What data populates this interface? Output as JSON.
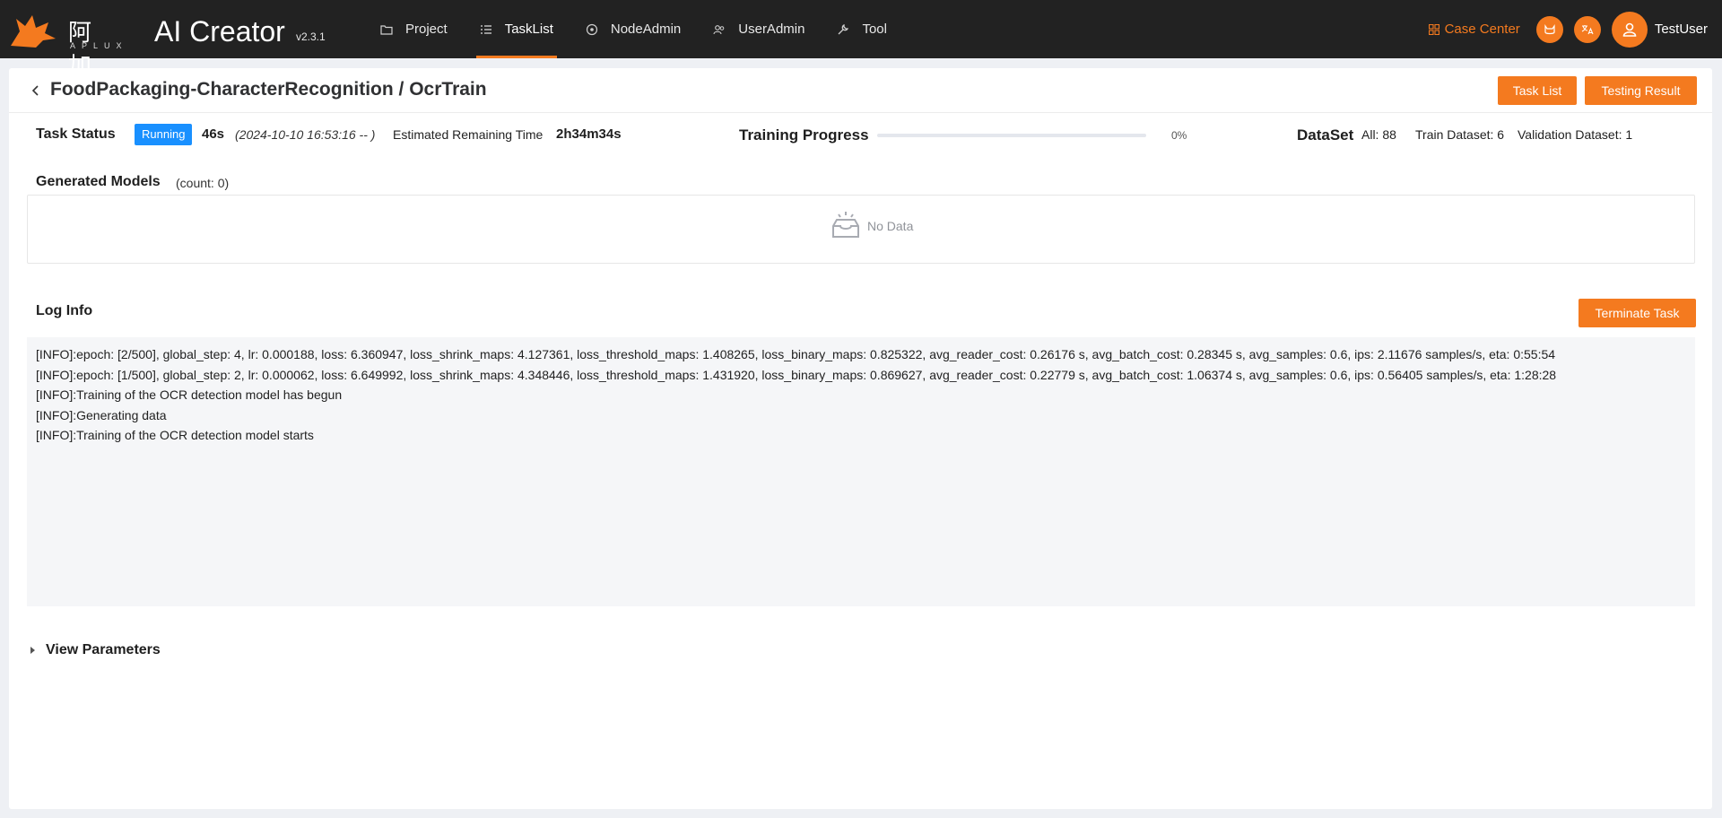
{
  "app": {
    "brand_cn": "阿加犀",
    "brand_sub": "APLUX",
    "brand_name": "AI Creator",
    "version": "v2.3.1",
    "accent_color": "#f47a1f"
  },
  "nav": {
    "items": [
      {
        "label": "Project",
        "icon": "folder-icon"
      },
      {
        "label": "TaskList",
        "icon": "tasklist-icon",
        "active": true
      },
      {
        "label": "NodeAdmin",
        "icon": "node-icon"
      },
      {
        "label": "UserAdmin",
        "icon": "users-icon"
      },
      {
        "label": "Tool",
        "icon": "wrench-icon"
      }
    ],
    "case_center": "Case Center",
    "username": "TestUser"
  },
  "page": {
    "title": "FoodPackaging-CharacterRecognition / OcrTrain",
    "task_list_button": "Task List",
    "testing_result_button": "Testing Result"
  },
  "status": {
    "label": "Task Status",
    "badge": "Running",
    "elapsed": "46s",
    "start_time": "(2024-10-10 16:53:16 -- )",
    "estimated_label": "Estimated Remaining Time",
    "estimated_value": "2h34m34s"
  },
  "progress": {
    "label": "Training Progress",
    "percent_text": "0%",
    "value": 0
  },
  "dataset": {
    "label": "DataSet",
    "all": "All: 88",
    "train": "Train Dataset: 6",
    "validation": "Validation Dataset: 1"
  },
  "models": {
    "title": "Generated Models",
    "count": "(count:  0)",
    "empty_text": "No Data"
  },
  "log": {
    "title": "Log Info",
    "terminate_button": "Terminate Task",
    "lines": [
      "[INFO]:epoch: [2/500], global_step: 4, lr: 0.000188, loss: 6.360947, loss_shrink_maps: 4.127361, loss_threshold_maps: 1.408265, loss_binary_maps: 0.825322, avg_reader_cost: 0.26176 s, avg_batch_cost: 0.28345 s, avg_samples: 0.6, ips: 2.11676 samples/s, eta: 0:55:54",
      "[INFO]:epoch: [1/500], global_step: 2, lr: 0.000062, loss: 6.649992, loss_shrink_maps: 4.348446, loss_threshold_maps: 1.431920, loss_binary_maps: 0.869627, avg_reader_cost: 0.22779 s, avg_batch_cost: 1.06374 s, avg_samples: 0.6, ips: 0.56405 samples/s, eta: 1:28:28",
      "[INFO]:Training of the OCR detection model has begun",
      "[INFO]:Generating data",
      "[INFO]:Training of the OCR detection model starts"
    ]
  },
  "params": {
    "label": "View Parameters"
  }
}
